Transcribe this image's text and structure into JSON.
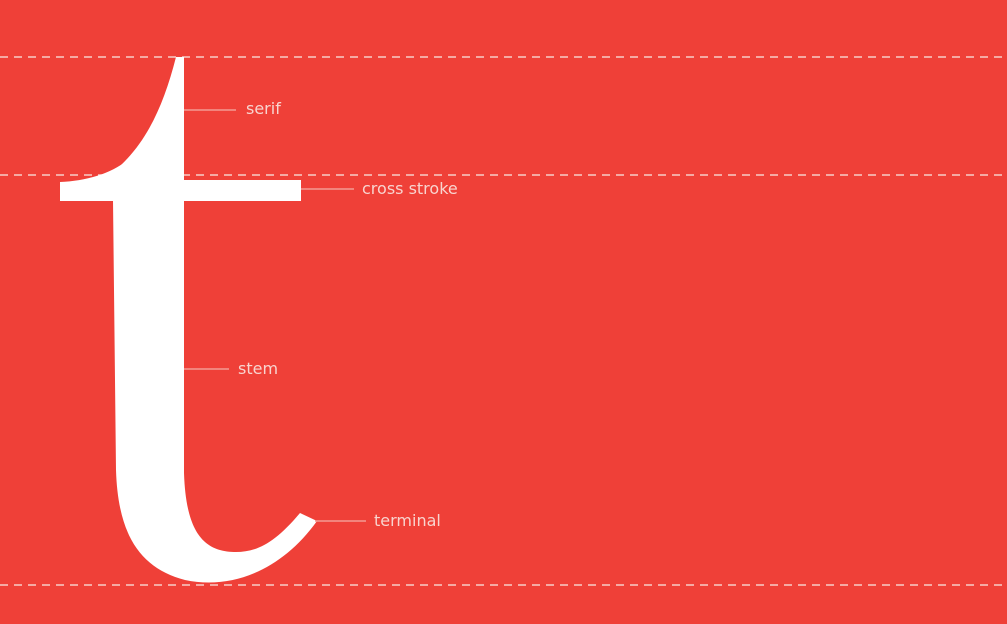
{
  "colors": {
    "background": "#ef4038",
    "glyph": "#ffffff",
    "guide": "#f7cdc8",
    "leader": "#f39a92",
    "label": "#f8d4cf"
  },
  "glyph": {
    "character": "t"
  },
  "labels": {
    "serif": "serif",
    "cross_stroke": "cross stroke",
    "stem": "stem",
    "terminal": "terminal"
  }
}
